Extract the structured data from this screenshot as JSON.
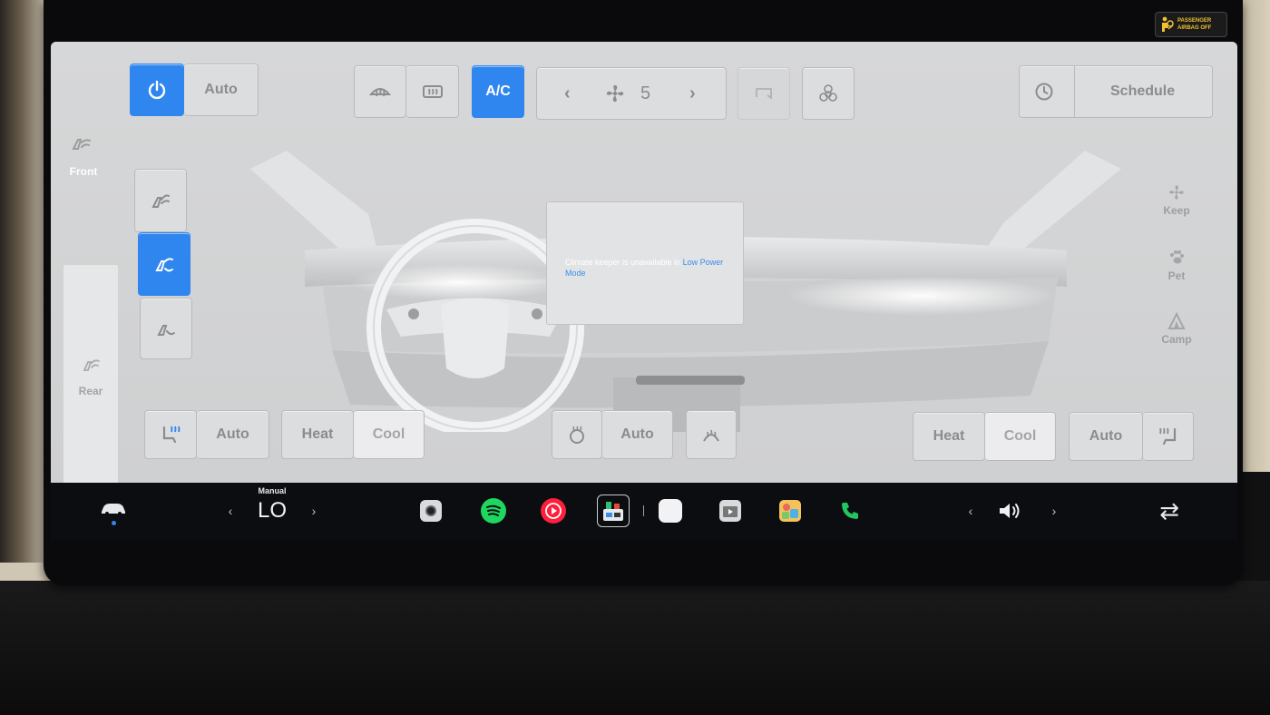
{
  "top_controls": {
    "power_label": "",
    "auto_label": "Auto",
    "ac_label": "A/C",
    "fan_speed": "5",
    "schedule_label": "Schedule"
  },
  "left_panel": {
    "front_label": "Front",
    "rear_label": "Rear"
  },
  "center_display": {
    "message_prefix": "Climate keeper is unavailable in ",
    "message_link": "Low Power Mode"
  },
  "right_modes": {
    "keep_label": "Keep",
    "pet_label": "Pet",
    "camp_label": "Camp"
  },
  "bottom_controls": {
    "driver_seat_auto": "Auto",
    "driver_heat": "Heat",
    "driver_cool": "Cool",
    "wheel_auto": "Auto",
    "passenger_heat": "Heat",
    "passenger_cool": "Cool",
    "passenger_seat_auto": "Auto"
  },
  "taskbar": {
    "temp_mode": "Manual",
    "temperature": "LO",
    "left_chevron": "‹",
    "right_chevron": "›",
    "vol_left_chevron": "‹",
    "vol_right_chevron": "›",
    "swap_icon": "⇄"
  },
  "airbag_indicator": {
    "line1": "PASSENGER",
    "line2": "AIRBAG OFF"
  },
  "colors": {
    "accent": "#2f86ef",
    "screen_bg": "#d4d5d6",
    "taskbar_bg": "#0b0d11",
    "spotify": "#1ed760",
    "youtube_music": "#ff1f3d",
    "phone": "#22c55e"
  }
}
